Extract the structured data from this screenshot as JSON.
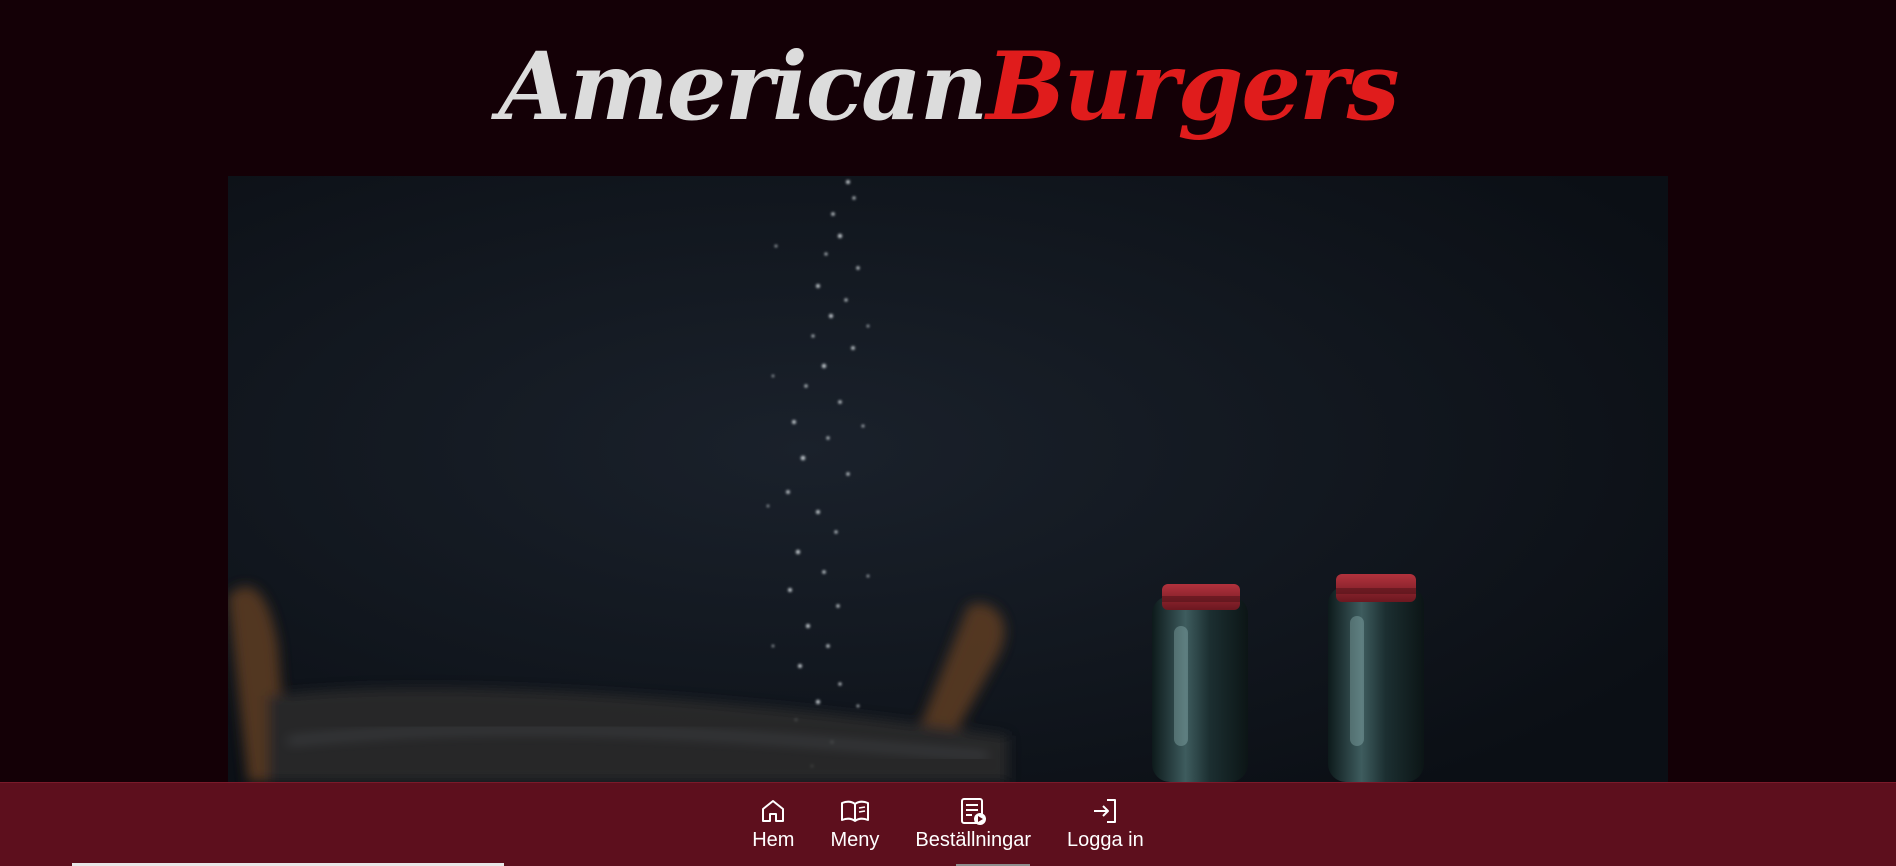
{
  "brand": {
    "part1": "American",
    "part2": "Burgers",
    "color_part1": "#dcdcdc",
    "color_part2": "#e01c1c"
  },
  "hero": {
    "description_icon": "hero-photo"
  },
  "nav": {
    "items": [
      {
        "label": "Hem",
        "icon": "home-icon"
      },
      {
        "label": "Meny",
        "icon": "book-open-icon"
      },
      {
        "label": "Beställningar",
        "icon": "orders-icon"
      },
      {
        "label": "Logga in",
        "icon": "login-icon"
      }
    ],
    "background": "#5d0f1d"
  },
  "colors": {
    "page_background": "#140006",
    "accent": "#e01c1c"
  }
}
